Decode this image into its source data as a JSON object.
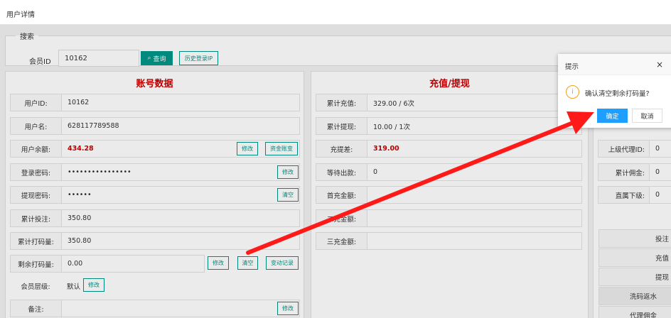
{
  "window": {
    "title": "用户详情"
  },
  "search": {
    "legend": "搜索",
    "label": "会员ID",
    "value": "10162",
    "query_button": "查询",
    "history_button": "历史登录IP"
  },
  "account": {
    "title": "账号数据",
    "rows": [
      {
        "label": "用户ID:",
        "value": "10162"
      },
      {
        "label": "用户名:",
        "value": "628117789588"
      },
      {
        "label": "用户余额:",
        "value": "434.28"
      },
      {
        "label": "登录密码:",
        "value": "••••••••••••••••"
      },
      {
        "label": "提现密码:",
        "value": "••••••"
      },
      {
        "label": "累计投注:",
        "value": "350.80"
      },
      {
        "label": "累计打码量:",
        "value": "350.80"
      },
      {
        "label": "剩余打码量:",
        "value": "0.00"
      },
      {
        "label": "会员层级:",
        "value": "默认"
      },
      {
        "label": "备注:",
        "value": ""
      }
    ],
    "buttons": {
      "balance_edit": "修改",
      "fund_account": "资金账变",
      "login_pwd_edit": "修改",
      "withdraw_pwd_clear": "清空",
      "remaining_edit": "修改",
      "remaining_clear": "清空",
      "change_record": "变动记录",
      "level_edit": "修改",
      "remark_edit": "修改"
    }
  },
  "recharge": {
    "title": "充值/提现",
    "rows": [
      {
        "label": "累计充值:",
        "value": "329.00 / 6次"
      },
      {
        "label": "累计提现:",
        "value": "10.00 / 1次"
      },
      {
        "label": "充提差:",
        "value": "319.00"
      },
      {
        "label": "等待出款:",
        "value": "0"
      },
      {
        "label": "首充金额:",
        "value": ""
      },
      {
        "label": "二充金额:",
        "value": ""
      },
      {
        "label": "三充金额:",
        "value": ""
      }
    ]
  },
  "agent": {
    "rows": [
      {
        "label": "上级代理ID:",
        "value": "0"
      },
      {
        "label": "累计佣金:",
        "value": "0"
      },
      {
        "label": "直属下级:",
        "value": "0"
      }
    ],
    "stats": [
      "投注",
      "充值",
      "提现",
      "洗码返水",
      "代理佣金"
    ]
  },
  "dialog": {
    "title": "提示",
    "close": "×",
    "icon": "i",
    "message": "确认清空剩余打码量?",
    "ok": "确定",
    "cancel": "取消"
  },
  "colors": {
    "accent": "#009688",
    "primary": "#1e9fff",
    "danger": "#cc0000",
    "arrow": "#ff1a1a"
  }
}
